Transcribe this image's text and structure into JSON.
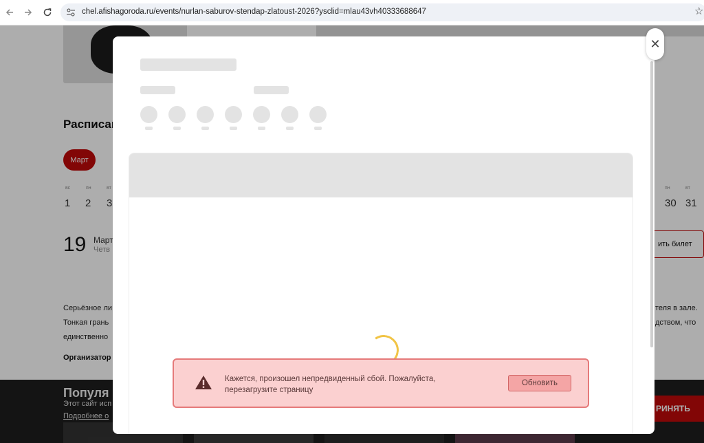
{
  "browser": {
    "url": "chel.afishagoroda.ru/events/nurlan-saburov-stendap-zlatoust-2026?ysclid=mlau43vh40333688647"
  },
  "page": {
    "schedule_title": "Расписан",
    "month_pill": "Март",
    "days_left": [
      {
        "dow": "вс",
        "num": "1"
      },
      {
        "dow": "пн",
        "num": "2"
      },
      {
        "dow": "вт",
        "num": "3"
      }
    ],
    "days_right": [
      {
        "dow": "пн",
        "num": "30"
      },
      {
        "dow": "вт",
        "num": "31"
      }
    ],
    "event": {
      "day": "19",
      "month": "Март",
      "weekday": "Четв",
      "ticket_label": "ить билет"
    },
    "description_left": [
      "Серьёзное ли",
      "Тонкая грань",
      "единственно"
    ],
    "description_right": [
      "теля в зале.",
      "дством, что"
    ],
    "organizer": "Организатор",
    "popular_title": "Популя",
    "cookie_text": "Этот сайт исп",
    "cookie_more": "Подробнее о",
    "accept_label": "РИНЯТЬ"
  },
  "modal": {
    "close_glyph": "✕"
  },
  "error": {
    "message": "Кажется, произошел непредвиденный сбой. Пожалуйста, перезагрузите страницу",
    "reload_label": "Обновить"
  }
}
